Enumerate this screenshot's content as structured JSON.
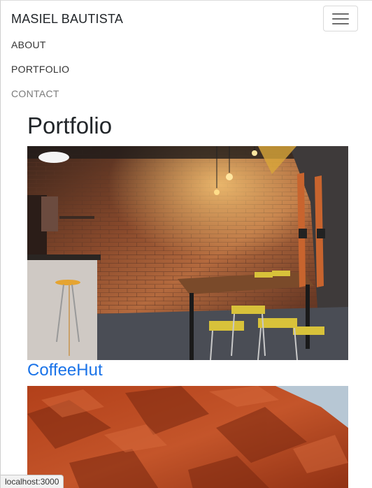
{
  "navbar": {
    "brand": "MASIEL BAUTISTA",
    "links": [
      {
        "label": "ABOUT"
      },
      {
        "label": "PORTFOLIO"
      },
      {
        "label": "CONTACT"
      }
    ]
  },
  "portfolio": {
    "heading": "Portfolio",
    "projects": [
      {
        "title": "CoffeeHut",
        "image": "cafe-interior-photo"
      },
      {
        "title": "",
        "image": "red-rock-photo"
      }
    ]
  },
  "status": {
    "url": "localhost:3000"
  },
  "colors": {
    "link": "#1a73e8",
    "text": "#212529"
  }
}
